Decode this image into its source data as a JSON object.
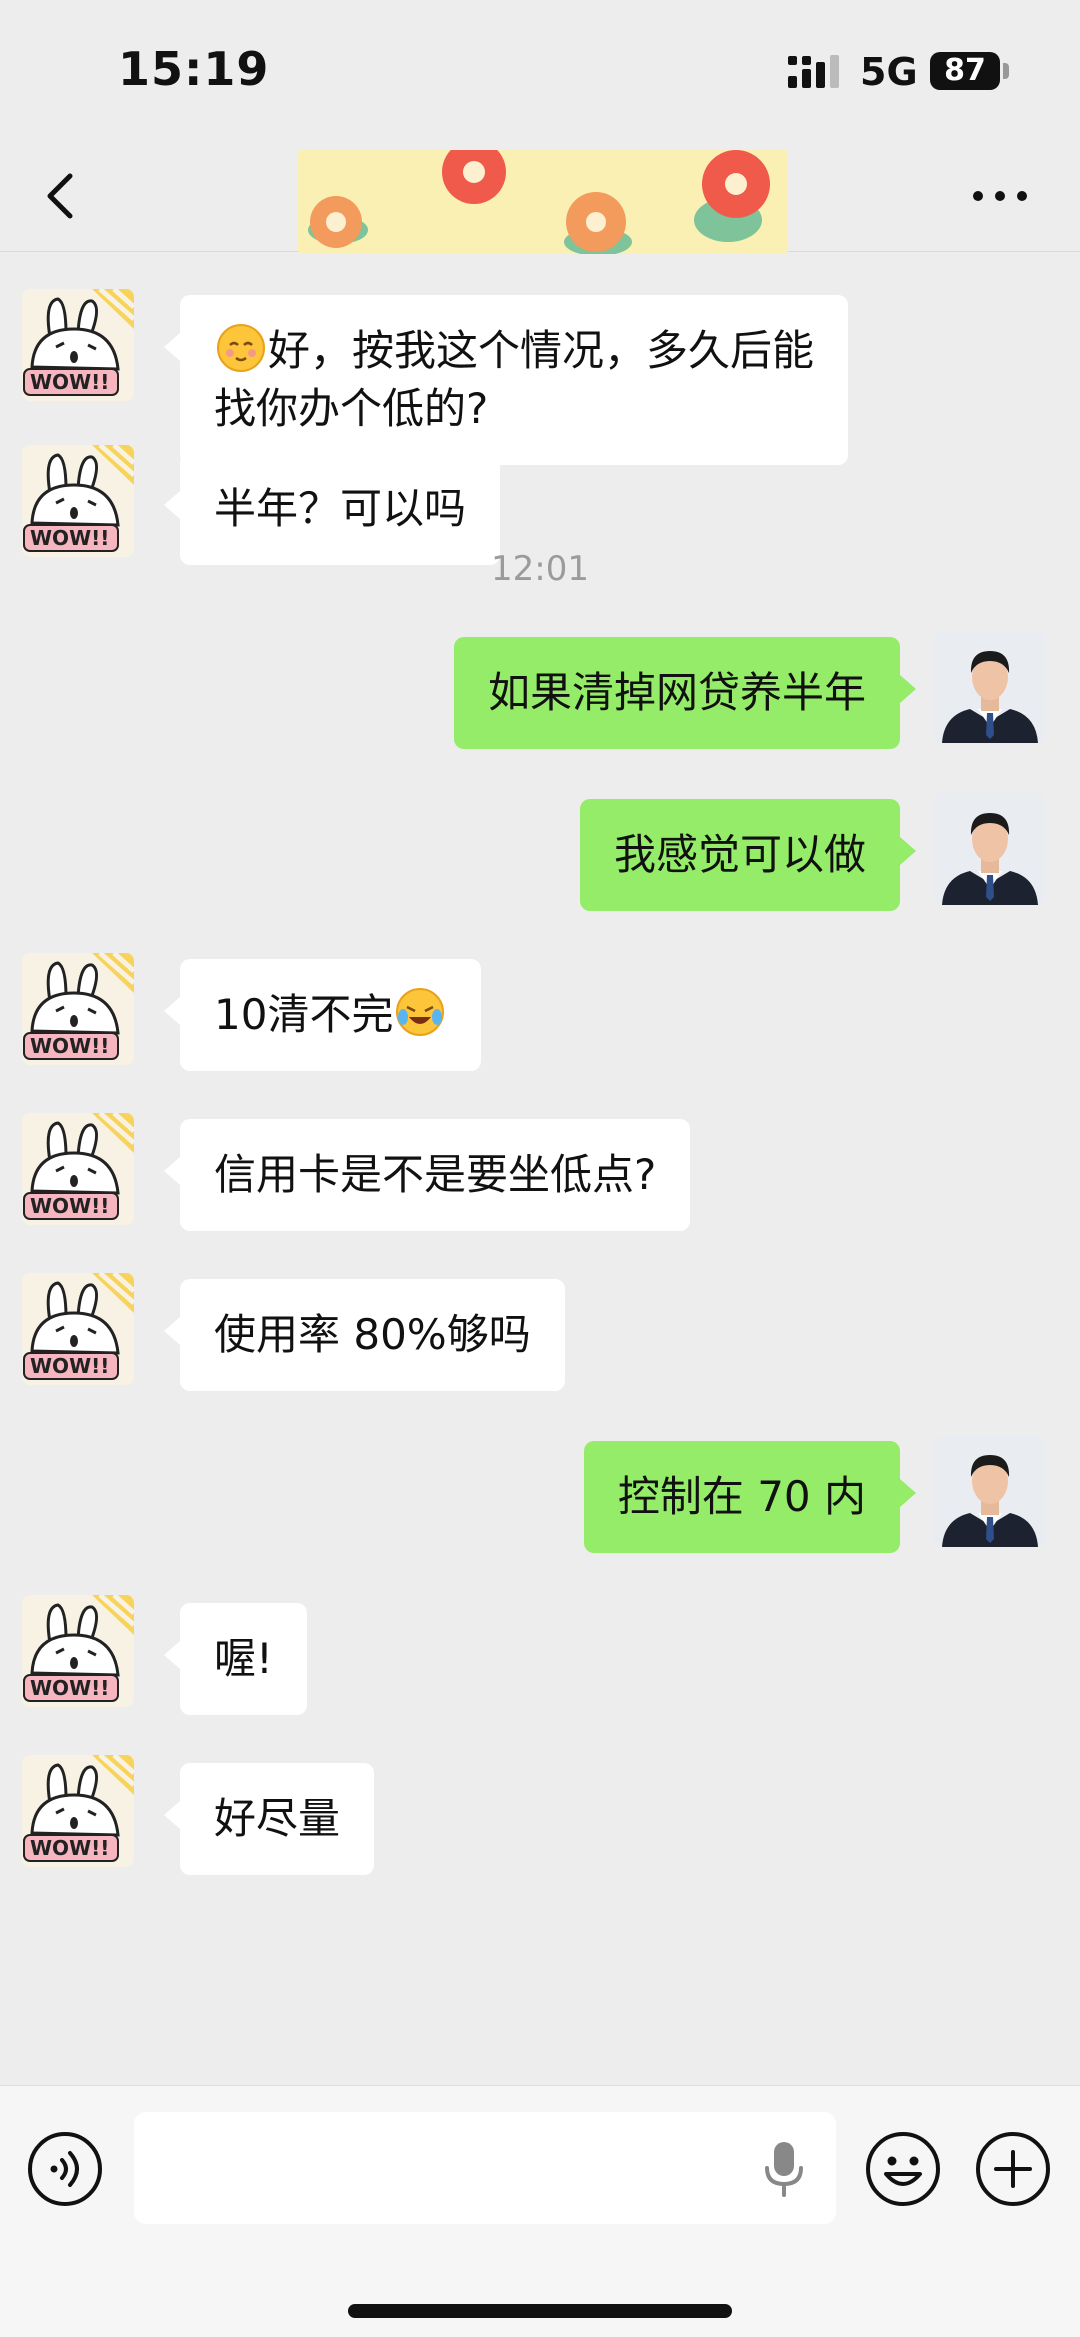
{
  "status_bar": {
    "time": "15:19",
    "network": "5G",
    "battery": "87"
  },
  "nav": {
    "back_icon": "chevron-left-icon",
    "more_icon": "ellipsis-icon"
  },
  "messages": [
    {
      "side": "in",
      "text": "好，按我这个情况，多久后能\n找你办个低的?",
      "emoji_prefix": "blush-emoji"
    },
    {
      "side": "in",
      "text": "半年？可以吗"
    },
    {
      "side": "time",
      "text": "12:01"
    },
    {
      "side": "out",
      "text": "如果清掉网贷养半年"
    },
    {
      "side": "out",
      "text": "我感觉可以做"
    },
    {
      "side": "in",
      "text": "10清不完",
      "emoji_suffix": "crying-laughing-emoji"
    },
    {
      "side": "in",
      "text": "信用卡是不是要坐低点?"
    },
    {
      "side": "in",
      "text": "使用率 80%够吗"
    },
    {
      "side": "out",
      "text": "控制在 70 内"
    },
    {
      "side": "in",
      "text": "喔!"
    },
    {
      "side": "in",
      "text": "好尽量"
    }
  ],
  "input_bar": {
    "voice_icon": "voice-mode-icon",
    "placeholder": "",
    "mic_icon": "microphone-icon",
    "emoji_icon": "smiley-icon",
    "plus_icon": "plus-icon"
  },
  "colors": {
    "background": "#ededed",
    "outgoing_bubble": "#95ec69",
    "incoming_bubble": "#ffffff",
    "timestamp": "#9b9b9b"
  }
}
